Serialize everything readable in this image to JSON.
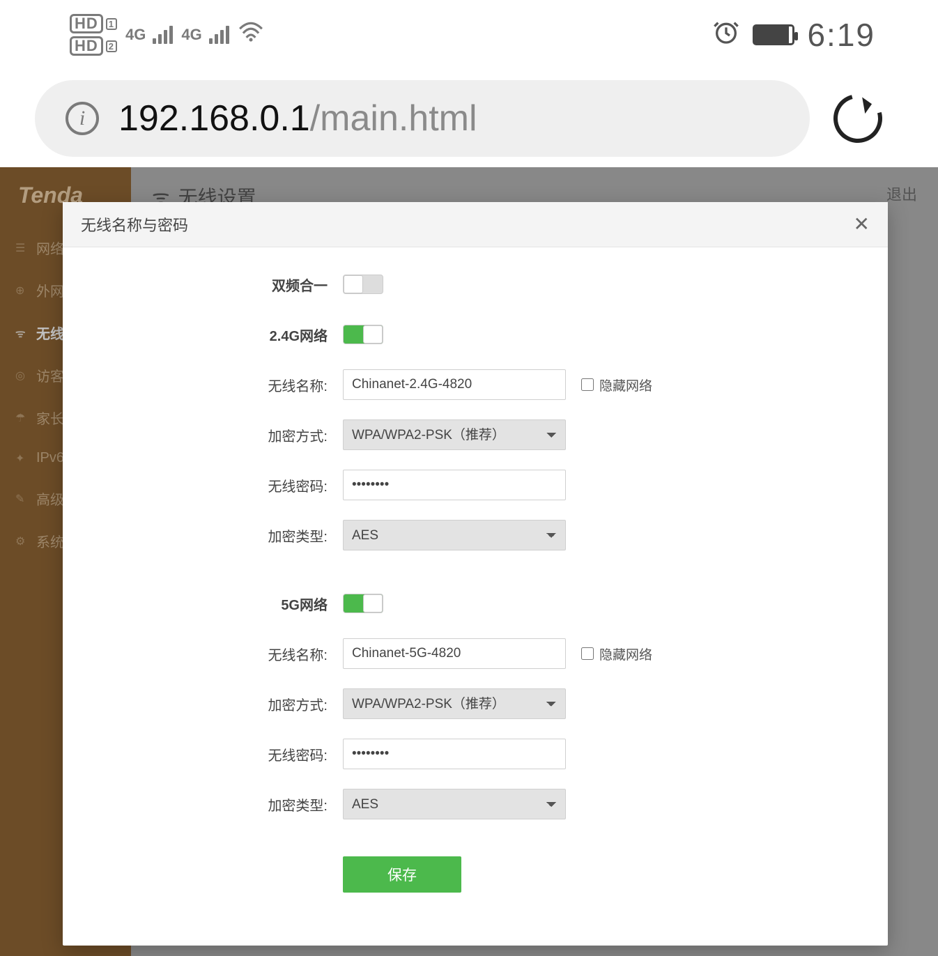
{
  "status_bar": {
    "hd1": "HD",
    "hd1_sub": "1",
    "hd2": "HD",
    "hd2_sub": "2",
    "sig1_label": "4G",
    "sig2_label": "4G",
    "time": "6:19"
  },
  "browser": {
    "url_host": "192.168.0.1",
    "url_path": "/main.html"
  },
  "router": {
    "brand": "Tenda",
    "page_title": "无线设置",
    "logout": "退出",
    "nav": {
      "net_status": "网络状",
      "wan": "外网设",
      "wireless": "无线设",
      "guest": "访客网",
      "parental": "家长控",
      "ipv6": "IPv6",
      "advanced": "高级功",
      "system": "系统管"
    }
  },
  "modal": {
    "title": "无线名称与密码",
    "labels": {
      "dualband": "双频合一",
      "net24": "2.4G网络",
      "net5": "5G网络",
      "ssid": "无线名称:",
      "enc_mode": "加密方式:",
      "password": "无线密码:",
      "enc_type": "加密类型:",
      "hide": "隐藏网络"
    },
    "values": {
      "ssid_24": "Chinanet-2.4G-4820",
      "enc_mode_24": "WPA/WPA2-PSK（推荐）",
      "password_24": "••••••••",
      "enc_type_24": "AES",
      "ssid_5": "Chinanet-5G-4820",
      "enc_mode_5": "WPA/WPA2-PSK（推荐）",
      "password_5": "••••••••",
      "enc_type_5": "AES"
    },
    "save": "保存"
  }
}
